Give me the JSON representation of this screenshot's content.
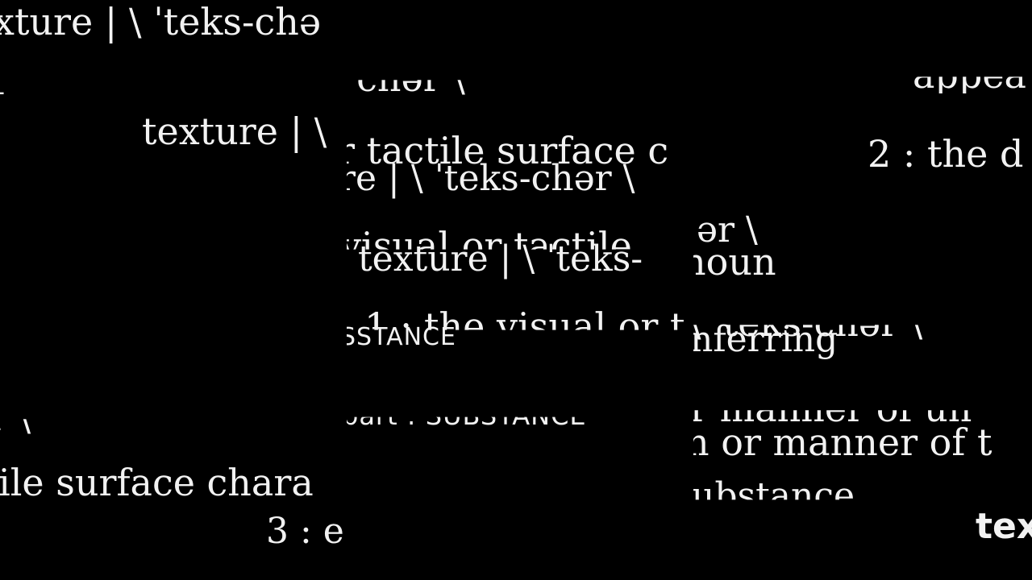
{
  "left": {
    "l1": "xture | \\ ˈteks-chə",
    "l2": "texture | \\",
    "l3": "r \\",
    "l4": "ile surface chara",
    "l5": "3 : e"
  },
  "middle": {
    "m1": "\\ chər \\",
    "m2": "r tactile surface c",
    "m3": "re | \\ ˈteks-chər \\",
    "m4": "visual or tactile",
    "m5": "texture | \\ ˈteks-",
    "m6": "1 : the visual or t",
    "m7": "SSTANCE",
    "m8": "part : SUBSTANCE"
  },
  "right": {
    "r1": "appea",
    "r2": "2 : the d",
    "r3": "ər \\",
    "r4": "noun",
    "r5": "\\ ˈteks-chər \\",
    "r6": "nferring",
    "r7": "r manner of un",
    "r8": "n or manner of t",
    "r9": "ubstance",
    "r10": "tex"
  }
}
